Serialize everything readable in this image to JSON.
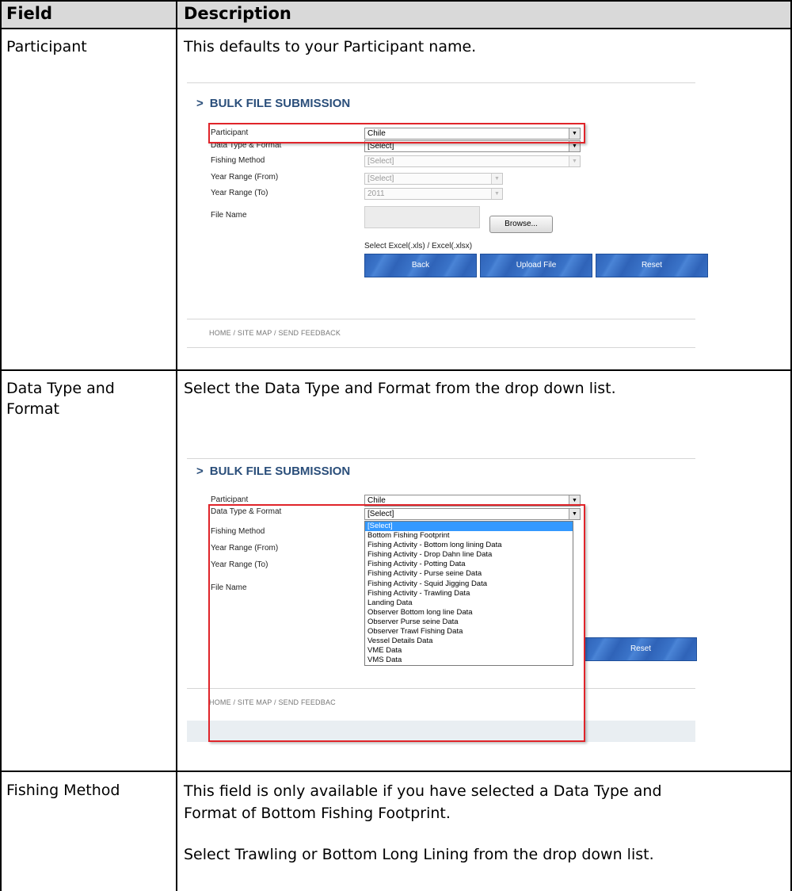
{
  "table": {
    "header_field": "Field",
    "header_description": "Description",
    "rows": [
      {
        "field": "Participant",
        "description": "This defaults to your Participant name."
      },
      {
        "field": "Data Type and Format",
        "description": "Select the Data Type and Format from the drop down list."
      },
      {
        "field": "Fishing Method",
        "description_1": "This field is only available if you have selected a Data Type and Format of Bottom Fishing Footprint.",
        "description_2": "Select Trawling or Bottom Long Lining from the drop down list."
      }
    ]
  },
  "shot1": {
    "title": "BULK FILE SUBMISSION",
    "labels": {
      "participant": "Participant",
      "data_type": "Data Type & Format",
      "fishing_method": "Fishing Method",
      "year_from": "Year Range (From)",
      "year_to": "Year Range (To)",
      "file_name": "File Name"
    },
    "values": {
      "participant": "Chile",
      "data_type": "[Select]",
      "fishing_method": "[Select]",
      "year_from": "[Select]",
      "year_to": "2011"
    },
    "browse_label": "Browse...",
    "hint": "Select Excel(.xls) / Excel(.xlsx)",
    "buttons": {
      "back": "Back",
      "upload": "Upload File",
      "reset": "Reset"
    },
    "footer": "HOME / SITE MAP / SEND FEEDBACK"
  },
  "shot2": {
    "title": "BULK FILE SUBMISSION",
    "labels": {
      "participant": "Participant",
      "data_type": "Data Type & Format",
      "fishing_method": "Fishing Method",
      "year_from": "Year Range (From)",
      "year_to": "Year Range (To)",
      "file_name": "File Name"
    },
    "values": {
      "participant": "Chile",
      "data_type": "[Select]"
    },
    "reset_label": "Reset",
    "footer": "HOME / SITE MAP / SEND FEEDBAC",
    "dropdown_options": [
      "[Select]",
      "Bottom Fishing Footprint",
      "Fishing Activity - Bottom long lining Data",
      "Fishing Activity - Drop Dahn line Data",
      "Fishing Activity - Potting Data",
      "Fishing Activity - Purse seine Data",
      "Fishing Activity - Squid Jigging Data",
      "Fishing Activity - Trawling Data",
      "Landing Data",
      "Observer Bottom long line Data",
      "Observer Purse seine Data",
      "Observer Trawl Fishing Data",
      "Vessel Details Data",
      "VME Data",
      "VMS Data"
    ],
    "highlighted_option": "[Select]"
  },
  "colors": {
    "title_blue": "#2a4e7a",
    "button_blue": "#3a73c8",
    "highlight_red": "#e0242a",
    "selection_blue": "#3399ff"
  }
}
